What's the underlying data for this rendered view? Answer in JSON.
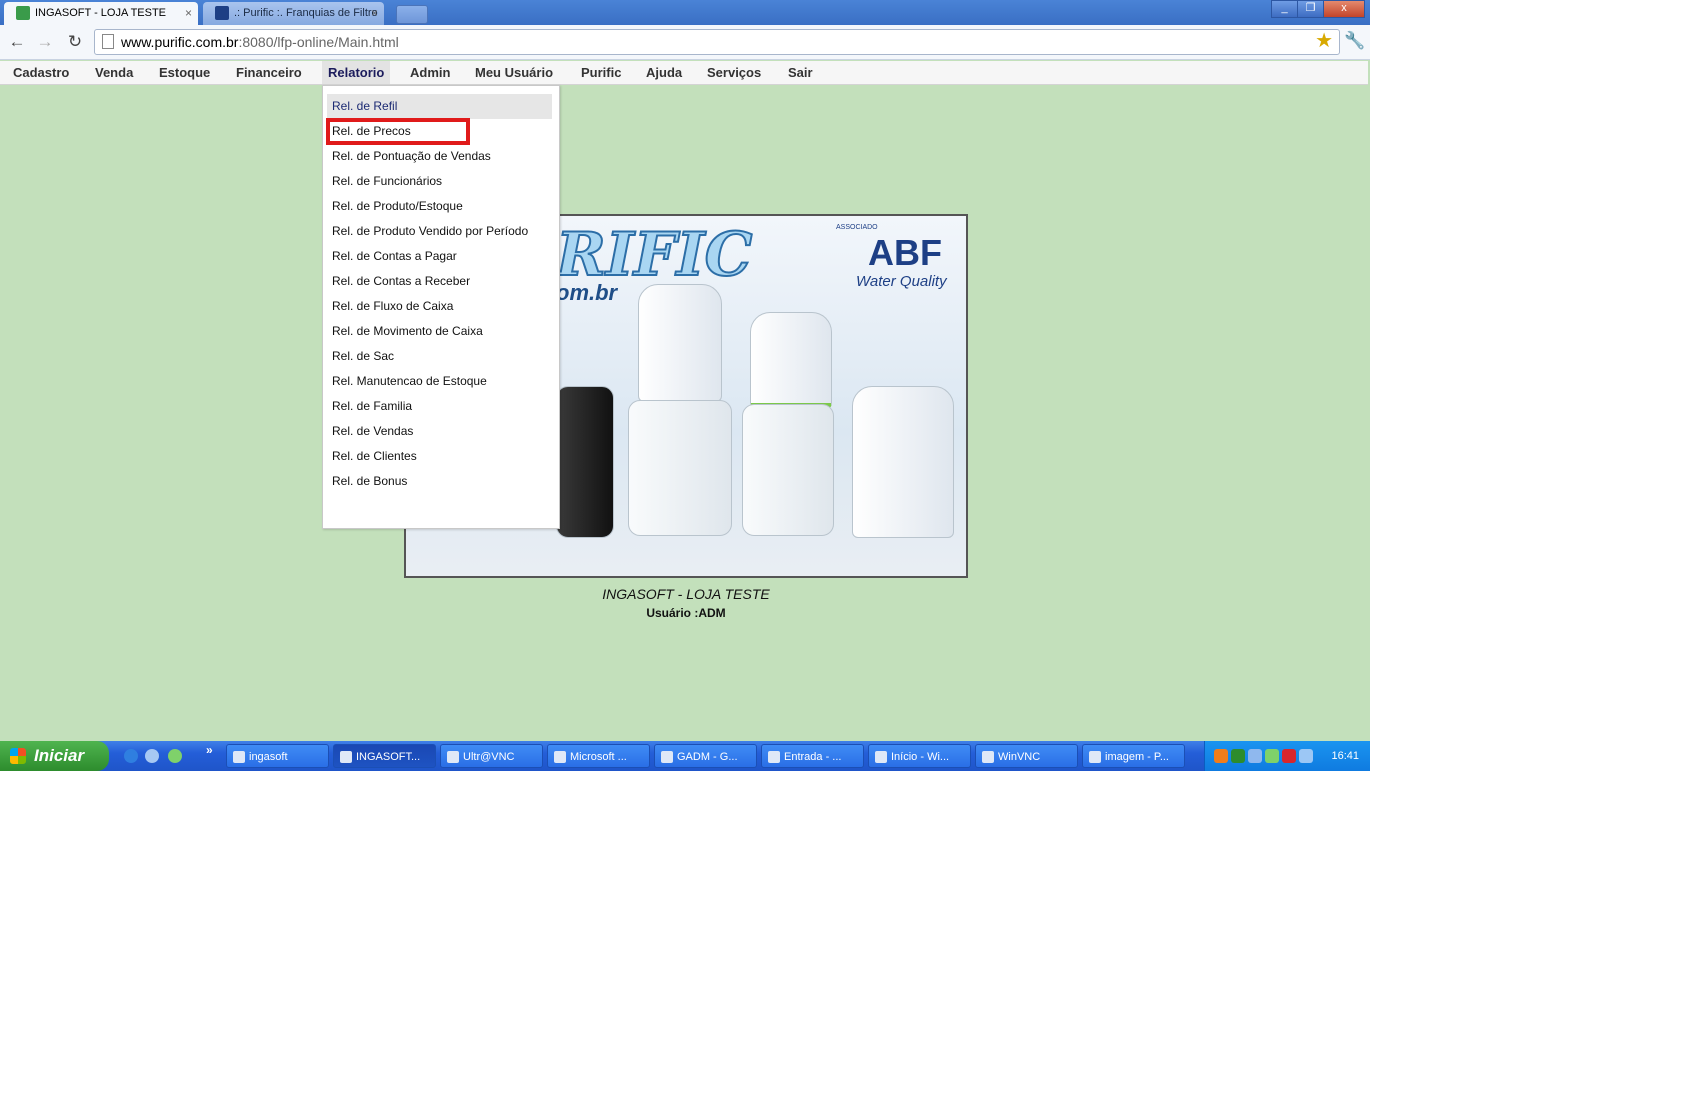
{
  "browser": {
    "tabs": [
      {
        "label": "INGASOFT - LOJA TESTE",
        "close": "×"
      },
      {
        "label": ".: Purific :. Franquias de Filtro",
        "close": "×"
      }
    ],
    "window_buttons": {
      "minimize": "_",
      "restore": "❐",
      "close": "x"
    },
    "url_host": "www.purific.com.br",
    "url_rest": ":8080/lfp-online/Main.html",
    "back_icon": "←",
    "forward_icon": "→",
    "reload_icon": "↻",
    "star_icon": "★",
    "wrench_icon": "🔧"
  },
  "menubar": {
    "items": [
      "Cadastro",
      "Venda",
      "Estoque",
      "Financeiro",
      "Relatorio",
      "Admin",
      "Meu Usuário",
      "Purific",
      "Ajuda",
      "Serviços",
      "Sair"
    ],
    "open_item": "Relatorio"
  },
  "dropdown": {
    "items": [
      "Rel. de Refil",
      "Rel. de Precos",
      "Rel. de Pontuação de Vendas",
      "Rel. de Funcionários",
      "Rel. de Produto/Estoque",
      "Rel. de Produto Vendido por Período",
      "Rel. de Contas a Pagar",
      "Rel. de Contas a Receber",
      "Rel. de Fluxo de Caixa",
      "Rel. de Movimento de Caixa",
      "Rel. de Sac",
      "Rel. Manutencao de Estoque",
      "Rel. de Familia",
      "Rel. de Vendas",
      "Rel. de Clientes",
      "Rel. de Bonus"
    ],
    "hovered": "Rel. de Refil",
    "highlighted": "Rel. de Precos",
    "highlight_color": "#e01a1a"
  },
  "banner": {
    "logo_text": "RIFIC",
    "web_text": "om.br",
    "abf_caption": "ASSOCIADO",
    "abf_text": "ABF",
    "water_quality": "Water Quality"
  },
  "content": {
    "store_name": "INGASOFT - LOJA TESTE",
    "user_line": "Usuário :ADM"
  },
  "taskbar": {
    "start_label": "Iniciar",
    "more": "»",
    "tasks": [
      "ingasoft",
      "INGASOFT...",
      "Ultr@VNC",
      "Microsoft ...",
      "GADM - G...",
      "Entrada - ...",
      "Início - Wi...",
      "WinVNC",
      "imagem - P..."
    ],
    "active_task": "INGASOFT...",
    "clock": "16:41"
  },
  "colors": {
    "page_background": "#c3e0bb",
    "taskbar": "#245ed8",
    "start_button": "#2d8c2d"
  }
}
